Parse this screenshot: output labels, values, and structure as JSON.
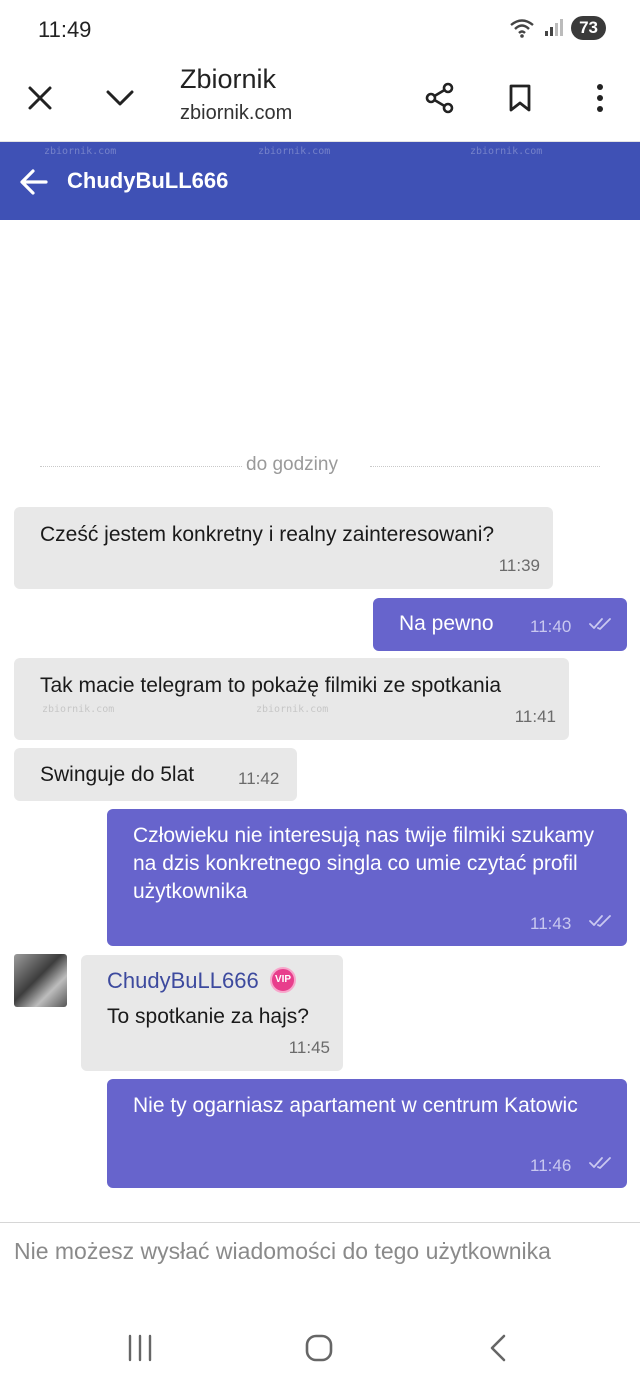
{
  "status": {
    "time": "11:49",
    "battery": "73"
  },
  "browser": {
    "title": "Zbiornik",
    "url": "zbiornik.com"
  },
  "chat": {
    "contact_name": "ChudyBuLL666",
    "watermark": "zbiornik.com"
  },
  "divider": {
    "label": "do godziny"
  },
  "messages": [
    {
      "dir": "in",
      "text": "Cześć jestem konkretny i realny zainteresowani?",
      "time": "11:39"
    },
    {
      "dir": "out",
      "text": "Na pewno",
      "time": "11:40"
    },
    {
      "dir": "in",
      "text": "Tak macie telegram to pokażę filmiki ze spotkania",
      "time": "11:41"
    },
    {
      "dir": "in",
      "text": "Swinguje do 5lat",
      "time": "11:42"
    },
    {
      "dir": "out",
      "text": "Człowieku nie interesują nas twije filmiki szukamy na dzis konkretnego singla co umie czytać profil użytkownika",
      "time": "11:43"
    },
    {
      "dir": "in",
      "sender": "ChudyBuLL666",
      "badge": "VIP",
      "text": "To spotkanie za hajs?",
      "time": "11:45"
    },
    {
      "dir": "out",
      "text": "Nie ty ogarniasz apartament w centrum Katowic",
      "time": "11:46"
    }
  ],
  "composer": {
    "notice": "Nie możesz wysłać wiadomości do tego użytkownika"
  },
  "colors": {
    "header": "#3f51b5",
    "outgoing": "#6764cc",
    "incoming": "#e8e8e8"
  }
}
